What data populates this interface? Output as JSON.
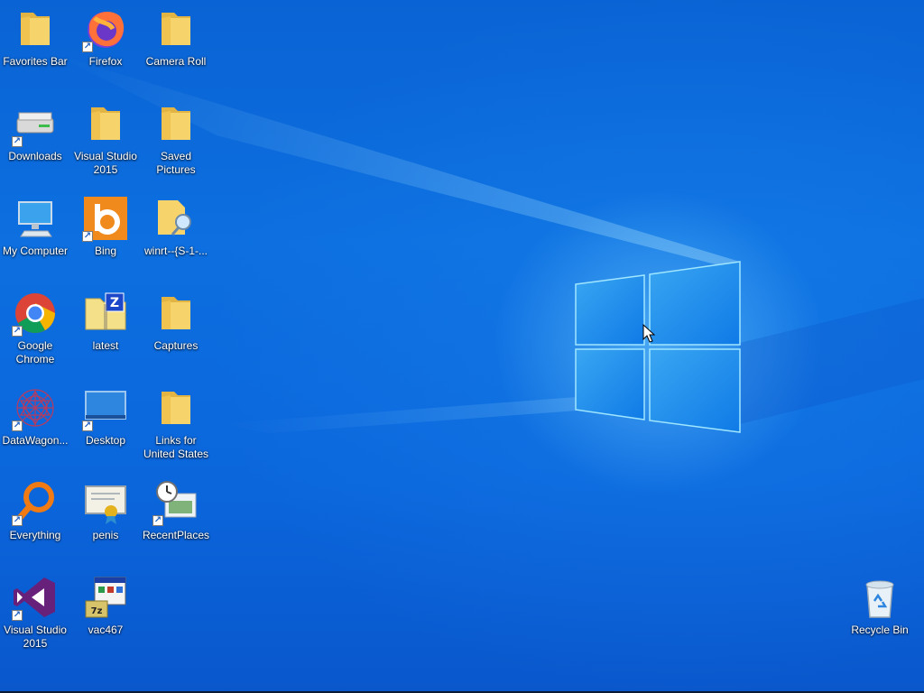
{
  "desktop": {
    "icons": [
      {
        "label": "Favorites Bar",
        "icon": "folder-icon",
        "shortcut": false
      },
      {
        "label": "Firefox",
        "icon": "firefox-icon",
        "shortcut": true
      },
      {
        "label": "Camera Roll",
        "icon": "folder-icon",
        "shortcut": false
      },
      {
        "label": "Downloads",
        "icon": "drive-icon",
        "shortcut": true
      },
      {
        "label": "Visual Studio 2015",
        "icon": "folder-icon",
        "shortcut": false
      },
      {
        "label": "Saved Pictures",
        "icon": "folder-icon",
        "shortcut": false
      },
      {
        "label": "My Computer",
        "icon": "computer-icon",
        "shortcut": false
      },
      {
        "label": "Bing",
        "icon": "bing-icon",
        "shortcut": true
      },
      {
        "label": "winrt--{S-1-...",
        "icon": "search-folder-icon",
        "shortcut": false
      },
      {
        "label": "Google Chrome",
        "icon": "chrome-icon",
        "shortcut": true
      },
      {
        "label": "latest",
        "icon": "zip-folder-icon",
        "shortcut": false
      },
      {
        "label": "Captures",
        "icon": "folder-icon",
        "shortcut": false
      },
      {
        "label": "DataWagon...",
        "icon": "datawagon-icon",
        "shortcut": true
      },
      {
        "label": "Desktop",
        "icon": "desktop-icon",
        "shortcut": true
      },
      {
        "label": "Links for United States",
        "icon": "folder-icon",
        "shortcut": false
      },
      {
        "label": "Everything",
        "icon": "everything-icon",
        "shortcut": true
      },
      {
        "label": "penis",
        "icon": "certificate-icon",
        "shortcut": false
      },
      {
        "label": "RecentPlaces",
        "icon": "recent-places-icon",
        "shortcut": true
      },
      {
        "label": "Visual Studio 2015",
        "icon": "visual-studio-icon",
        "shortcut": true
      },
      {
        "label": "vac467",
        "icon": "installer-icon",
        "shortcut": false
      },
      {
        "label": "Recycle Bin",
        "icon": "recycle-bin-icon",
        "shortcut": false
      }
    ]
  },
  "colors": {
    "wallpaper": "#0a63d4",
    "logo_glow": "#78d2ff",
    "label_text": "#ffffff"
  }
}
